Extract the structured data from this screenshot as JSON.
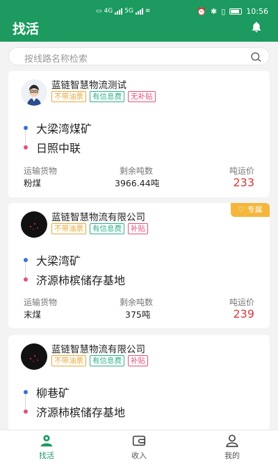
{
  "status": {
    "time": "10:56",
    "battery_text": "",
    "net_label_1": "4G",
    "net_label_2": "5G"
  },
  "app": {
    "title": "找活",
    "accent": "#1c9a5f"
  },
  "search": {
    "placeholder": "按线路名称检索"
  },
  "cards": [
    {
      "company": "蓝链智慧物流测试",
      "tags": [
        "不带油票",
        "有信息费",
        "无补贴"
      ],
      "from": "大梁湾煤矿",
      "to": "日照中联",
      "goods_label": "运输货物",
      "goods": "粉煤",
      "remain_label": "剩余吨数",
      "remain": "3966.44吨",
      "price_label": "吨运价",
      "price": "233",
      "exclusive": ""
    },
    {
      "company": "蓝链智慧物流有限公司",
      "tags": [
        "不带油票",
        "有信息费",
        "补贴"
      ],
      "from": "大梁湾矿",
      "to": "济源柿槟储存基地",
      "goods_label": "运输货物",
      "goods": "末煤",
      "remain_label": "剩余吨数",
      "remain": "375吨",
      "price_label": "吨运价",
      "price": "239",
      "exclusive": "专属"
    },
    {
      "company": "蓝链智慧物流有限公司",
      "tags": [
        "不带油票",
        "有信息费",
        "补贴"
      ],
      "from": "柳巷矿",
      "to": "济源柿槟储存基地"
    }
  ],
  "tabs": [
    {
      "label": "找活",
      "icon": "find-work-icon"
    },
    {
      "label": "收入",
      "icon": "wallet-icon"
    },
    {
      "label": "我的",
      "icon": "profile-icon"
    }
  ]
}
